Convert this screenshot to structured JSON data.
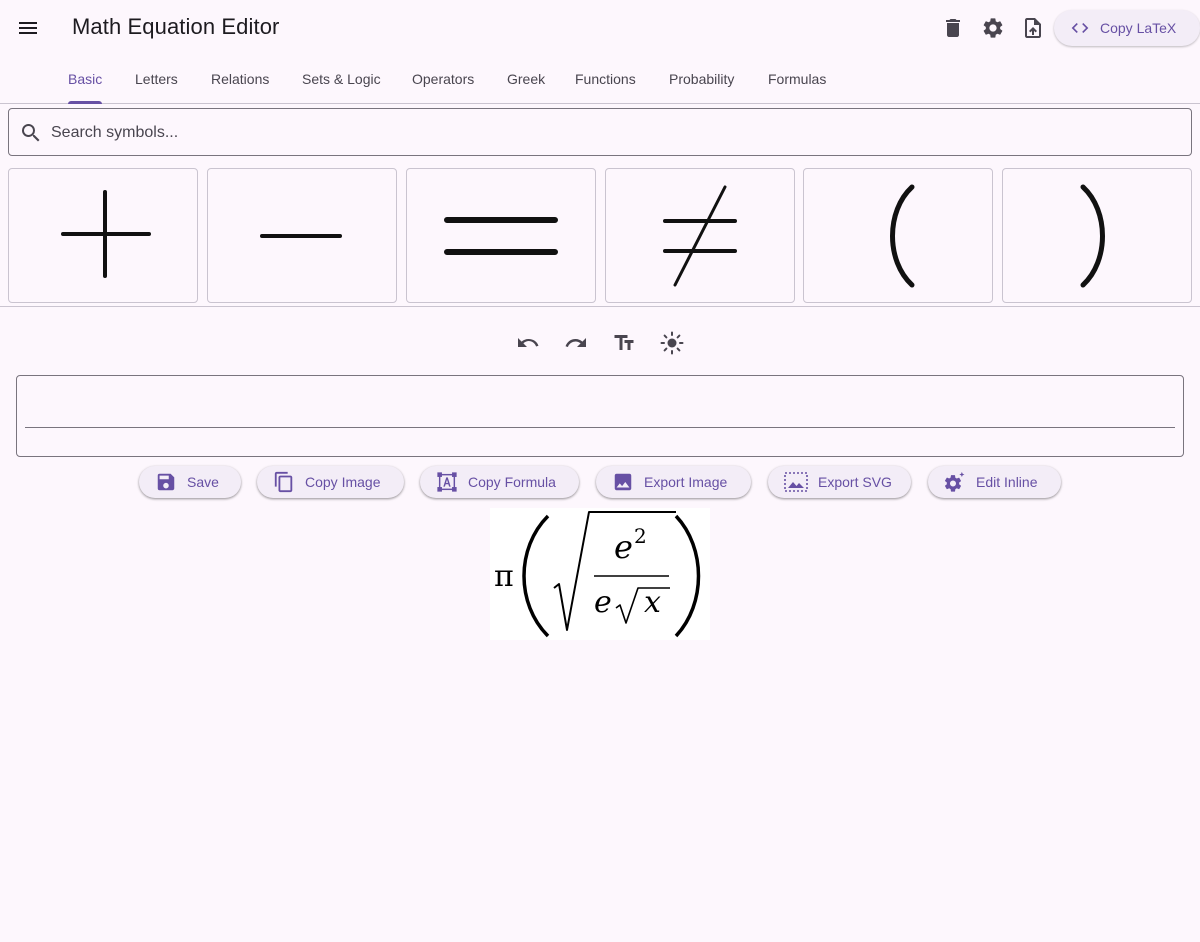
{
  "app": {
    "title": "Math Equation Editor"
  },
  "appbar": {
    "menu_icon": "menu-icon",
    "actions": [
      "delete-icon",
      "settings-icon",
      "upload-file-icon"
    ],
    "copy_latex_label": "Copy LaTeX",
    "copy_latex_icon": "code-icon"
  },
  "tabs": [
    {
      "label": "Basic",
      "active": true
    },
    {
      "label": "Letters"
    },
    {
      "label": "Relations"
    },
    {
      "label": "Sets & Logic"
    },
    {
      "label": "Operators"
    },
    {
      "label": "Greek"
    },
    {
      "label": "Functions"
    },
    {
      "label": "Probability"
    },
    {
      "label": "Formulas"
    }
  ],
  "search": {
    "placeholder": "Search symbols...",
    "value": ""
  },
  "symbols": [
    {
      "name": "plus",
      "glyph": "+"
    },
    {
      "name": "minus",
      "glyph": "−"
    },
    {
      "name": "equals",
      "glyph": "="
    },
    {
      "name": "not-equals",
      "glyph": "≠"
    },
    {
      "name": "left-paren",
      "glyph": "("
    },
    {
      "name": "right-paren",
      "glyph": ")"
    }
  ],
  "editor_toolbar": [
    "undo-icon",
    "redo-icon",
    "text-size-icon",
    "brightness-icon"
  ],
  "editor": {
    "value": ""
  },
  "actions": {
    "save": "Save",
    "copy_image": "Copy Image",
    "copy_formula": "Copy Formula",
    "export_image": "Export Image",
    "export_svg": "Export SVG",
    "edit_inline": "Edit Inline"
  },
  "preview": {
    "pi": "π",
    "numerator_base": "e",
    "numerator_exp": "2",
    "denominator_e": "e",
    "denominator_x": "x"
  },
  "colors": {
    "accent": "#6750a4",
    "background": "#fdf7fd",
    "surface_container": "#f3edf7",
    "outline": "#79747e"
  }
}
